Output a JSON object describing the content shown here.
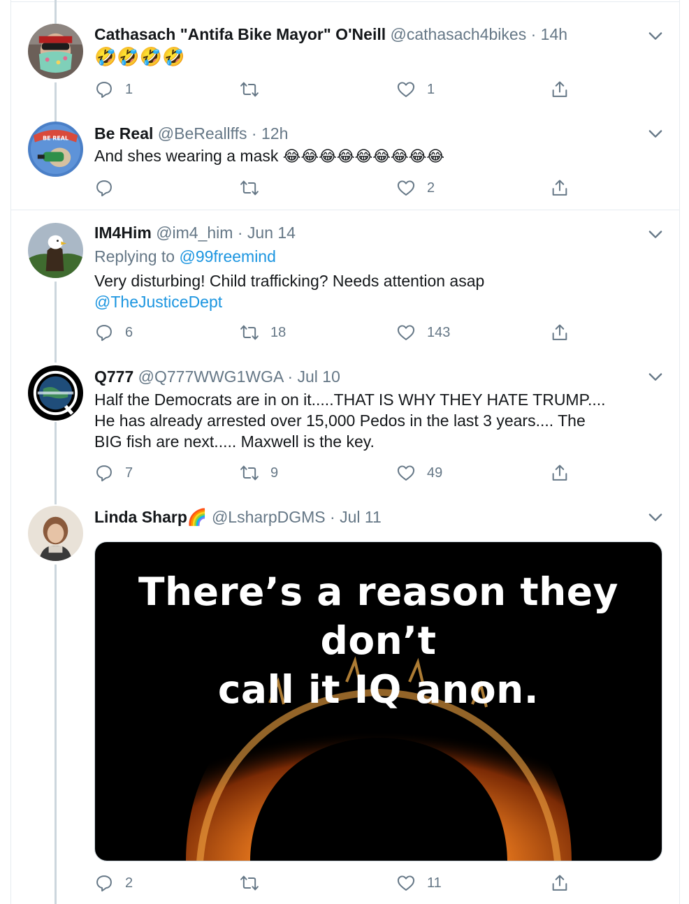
{
  "tweets": [
    {
      "name": "Cathasach \"Antifa Bike Mayor\" O'Neill",
      "handle": "@cathasach4bikes",
      "time": "14h",
      "emoji_text": "🤣🤣🤣🤣",
      "reply_count": "1",
      "retweet_count": "",
      "like_count": "1"
    },
    {
      "name": "Be Real",
      "handle": "@BeReallffs",
      "time": "12h",
      "text": "And shes wearing a mask",
      "emoji_text": "😂😂😂😂😂😂😂😂😂",
      "reply_count": "",
      "retweet_count": "",
      "like_count": "2"
    },
    {
      "name": "IM4Him",
      "handle": "@im4_him",
      "time": "Jun 14",
      "replying_label": "Replying to",
      "replying_to": "@99freemind",
      "text": "Very disturbing! Child trafficking? Needs attention asap",
      "mention": "@TheJusticeDept",
      "reply_count": "6",
      "retweet_count": "18",
      "like_count": "143"
    },
    {
      "name": "Q777",
      "handle": "@Q777WWG1WGA",
      "time": "Jul 10",
      "text_lines": [
        "Half the Democrats are in on it.....THAT IS WHY THEY HATE TRUMP....",
        "He has already arrested over 15,000 Pedos in the last 3 years.... The",
        "BIG fish are next..... Maxwell is the key."
      ],
      "reply_count": "7",
      "retweet_count": "9",
      "like_count": "49"
    },
    {
      "name": "Linda Sharp",
      "name_emoji": "🌈",
      "handle": "@LsharpDGMS",
      "time": "Jul 11",
      "media_caption_line1": "There’s a reason they don’t",
      "media_caption_line2": "call it IQ anon.",
      "reply_count": "2",
      "retweet_count": "",
      "like_count": "11"
    }
  ],
  "separator": "·",
  "icons": [
    "reply-icon",
    "retweet-icon",
    "like-icon",
    "share-icon",
    "chevron-down-icon"
  ],
  "colors": {
    "link": "#1b95e0",
    "muted": "#657786",
    "thread_line": "#ccd6dd",
    "divider": "#e6ecf0"
  }
}
